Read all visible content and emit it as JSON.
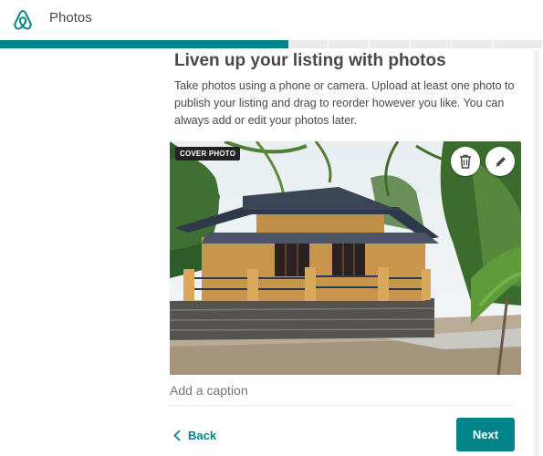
{
  "header": {
    "title": "Photos",
    "logo_icon": "airbnb-logo-icon",
    "brand_color": "#008489"
  },
  "progress": {
    "completed_fraction": 0.53
  },
  "main": {
    "heading": "Liven up your listing with photos",
    "description": "Take photos using a phone or camera. Upload at least one photo to publish your listing and drag to reorder however you like. You can always add or edit your photos later."
  },
  "photo": {
    "badge": "COVER PHOTO",
    "delete_icon": "trash-icon",
    "edit_icon": "pencil-icon"
  },
  "caption": {
    "placeholder": "Add a caption"
  },
  "footer": {
    "back_label": "Back",
    "next_label": "Next"
  }
}
